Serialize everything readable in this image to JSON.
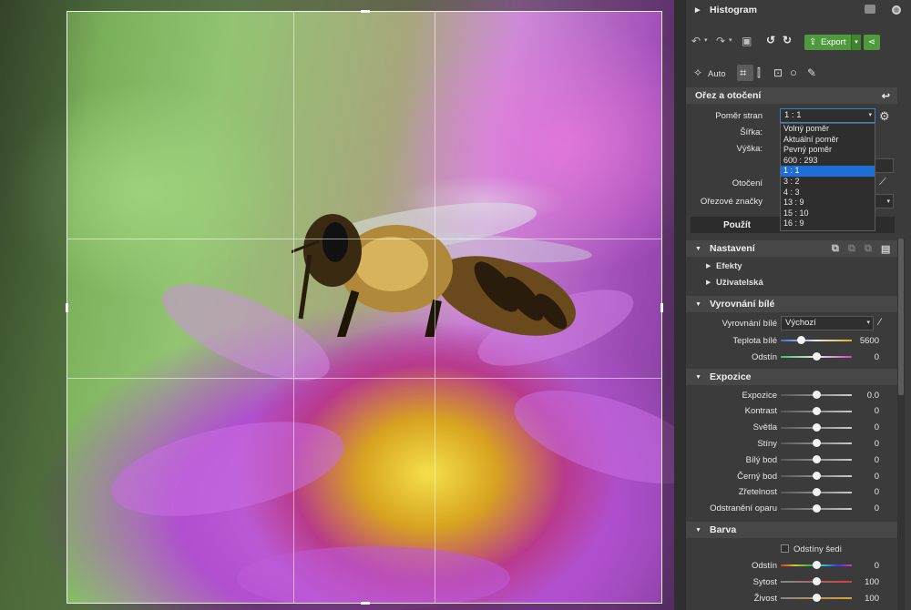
{
  "histogram": {
    "title": "Histogram"
  },
  "toolbar": {
    "export_label": "Export",
    "auto_label": "Auto"
  },
  "crop": {
    "title": "Ořez a otočení",
    "ratio_label": "Poměr stran",
    "ratio_value": "1 : 1",
    "width_label": "Šířka:",
    "height_label": "Výška:",
    "rotation_label": "Otočení",
    "marks_label": "Ořezové značky",
    "apply_label": "Použít",
    "ratio_options": [
      "Volný poměr",
      "Aktuální poměr",
      "Pevný poměr",
      "600 : 293",
      "1 : 1",
      "3 : 2",
      "4 : 3",
      "13 : 9",
      "15 : 10",
      "16 : 9"
    ],
    "selected_index": 4
  },
  "settings": {
    "title": "Nastavení",
    "effects": "Efekty",
    "user": "Uživatelská"
  },
  "white_balance": {
    "title": "Vyrovnání bílé",
    "wb_label": "Vyrovnání bílé",
    "wb_value": "Výchozí",
    "temp_label": "Teplota bílé",
    "temp_value": "5600",
    "temp_level": 0.28,
    "tint_label": "Odstín",
    "tint_value": "0",
    "tint_level": 0.5
  },
  "exposure": {
    "title": "Expozice",
    "items": [
      {
        "label": "Expozice",
        "value": "0.0",
        "level": 0.5
      },
      {
        "label": "Kontrast",
        "value": "0",
        "level": 0.5
      },
      {
        "label": "Světla",
        "value": "0",
        "level": 0.5
      },
      {
        "label": "Stíny",
        "value": "0",
        "level": 0.5
      },
      {
        "label": "Bílý bod",
        "value": "0",
        "level": 0.5
      },
      {
        "label": "Černý bod",
        "value": "0",
        "level": 0.5
      },
      {
        "label": "Zřetelnost",
        "value": "0",
        "level": 0.5
      },
      {
        "label": "Odstranění oparu",
        "value": "0",
        "level": 0.5
      }
    ]
  },
  "color": {
    "title": "Barva",
    "grayscale_label": "Odstíny šedi",
    "items": [
      {
        "label": "Odstín",
        "value": "0",
        "level": 0.5
      },
      {
        "label": "Sytost",
        "value": "100",
        "level": 0.5
      },
      {
        "label": "Živost",
        "value": "100",
        "level": 0.5
      }
    ]
  },
  "icons": [
    "chevron-right-icon",
    "camera-icon",
    "record-icon",
    "undo-icon",
    "redo-icon",
    "image-icon",
    "rotate-left-icon",
    "rotate-right-icon",
    "share-icon",
    "wand-icon",
    "crop-icon",
    "perspective-icon",
    "upright-icon",
    "circle-icon",
    "brush-icon",
    "reset-icon",
    "gear-icon",
    "copy-icon",
    "paste-icon",
    "save-icon",
    "eyedropper-icon"
  ]
}
